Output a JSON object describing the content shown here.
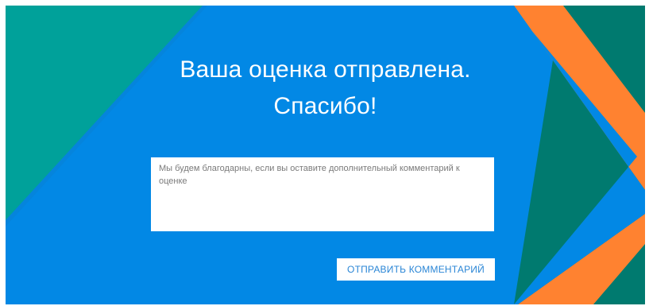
{
  "colors": {
    "background_blue": "#0288E5",
    "teal": "#00A19A",
    "teal_dark": "#007A6F",
    "orange": "#FF8230",
    "button_text": "#2A86D6"
  },
  "confirmation": {
    "title_line1": "Ваша оценка отправлена.",
    "title_line2": "Спасибо!"
  },
  "comment": {
    "placeholder": "Мы будем благодарны, если вы оставите дополнительный комментарий к оценке",
    "value": ""
  },
  "actions": {
    "send_comment_label": "ОТПРАВИТЬ КОММЕНТАРИЙ"
  }
}
